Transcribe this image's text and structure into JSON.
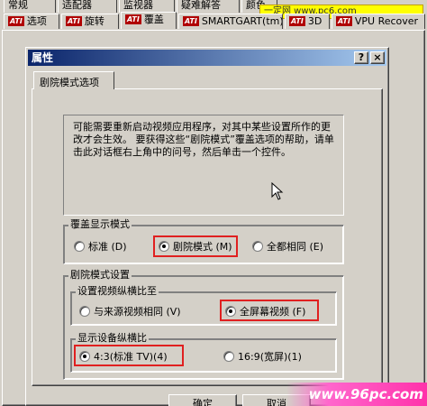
{
  "tabs_row1": [
    "常规",
    "适配器",
    "监视器",
    "疑难解答",
    "颜色"
  ],
  "tabs_row2": [
    {
      "label": "选项",
      "ati": true
    },
    {
      "label": "旋转",
      "ati": true
    },
    {
      "label": "覆盖",
      "ati": true,
      "active": true
    },
    {
      "label": "SMARTGART(tm)",
      "ati": true
    },
    {
      "label": "3D",
      "ati": true
    },
    {
      "label": "VPU Recover",
      "ati": true
    }
  ],
  "ati_logo": "ATI",
  "watermark_top": "一定网 www.pc6.com",
  "dialog": {
    "title": "属性",
    "help_button": "?",
    "close_button": "×",
    "tab_label": "剧院模式选项",
    "info_text": "可能需要重新启动视频应用程序，对其中某些设置所作的更改才会生效。 要获得这些“剧院模式”覆盖选项的帮助，请单击此对话框右上角中的问号，然后单击一个控件。",
    "overlay_mode": {
      "legend": "覆盖显示模式",
      "options": [
        "标准 (D)",
        "剧院模式 (M)",
        "全都相同 (E)"
      ],
      "selected_index": 1
    },
    "theater_settings": {
      "legend": "剧院模式设置",
      "video_aspect": {
        "legend": "设置视频纵横比至",
        "options": [
          "与来源视频相同 (V)",
          "全屏幕视频 (F)"
        ],
        "selected_index": 1
      },
      "device_aspect": {
        "legend": "显示设备纵横比",
        "options": [
          "4:3(标准 TV)(4)",
          "16:9(宽屏)(1)"
        ],
        "selected_index": 0
      }
    },
    "ok_button": "确定",
    "cancel_button": "取消"
  },
  "watermark_bottom": "www.96pc.com",
  "colors": {
    "highlight": "#e02020",
    "title_start": "#0a246a",
    "title_end": "#a6caf0",
    "ati_red": "#b00000"
  }
}
